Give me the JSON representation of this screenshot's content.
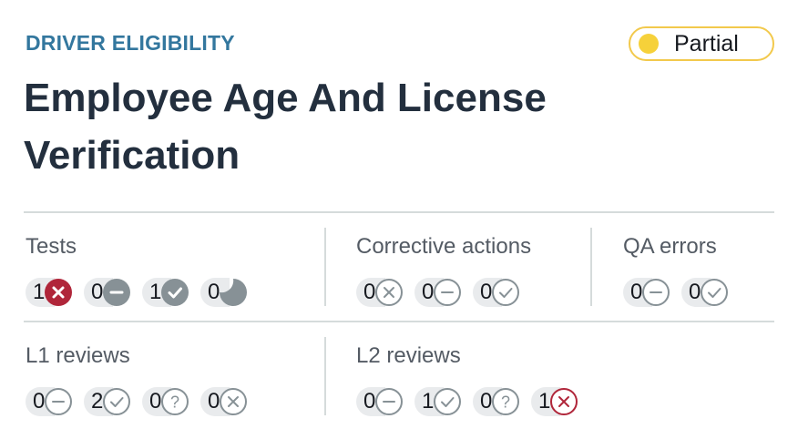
{
  "header": {
    "category": "DRIVER ELIGIBILITY",
    "title": "Employee Age And License Verification",
    "status": {
      "label": "Partial",
      "color": "#f6d13a",
      "border_color": "#f2c94c"
    }
  },
  "sections": {
    "tests": {
      "title": "Tests",
      "badges": [
        {
          "count": "1",
          "icon": "failed-icon"
        },
        {
          "count": "0",
          "icon": "not-applicable-icon"
        },
        {
          "count": "1",
          "icon": "passed-icon"
        },
        {
          "count": "0",
          "icon": "in-progress-icon"
        }
      ]
    },
    "corrective_actions": {
      "title": "Corrective actions",
      "badges": [
        {
          "count": "0",
          "icon": "rejected-outline-icon"
        },
        {
          "count": "0",
          "icon": "not-applicable-outline-icon"
        },
        {
          "count": "0",
          "icon": "approved-outline-icon"
        }
      ]
    },
    "qa_errors": {
      "title": "QA errors",
      "badges": [
        {
          "count": "0",
          "icon": "not-applicable-outline-icon"
        },
        {
          "count": "0",
          "icon": "approved-outline-icon"
        }
      ]
    },
    "l1_reviews": {
      "title": "L1 reviews",
      "badges": [
        {
          "count": "0",
          "icon": "not-applicable-outline-icon"
        },
        {
          "count": "2",
          "icon": "approved-outline-icon"
        },
        {
          "count": "0",
          "icon": "pending-outline-icon"
        },
        {
          "count": "0",
          "icon": "rejected-outline-icon"
        }
      ]
    },
    "l2_reviews": {
      "title": "L2 reviews",
      "badges": [
        {
          "count": "0",
          "icon": "not-applicable-outline-icon"
        },
        {
          "count": "1",
          "icon": "approved-outline-icon"
        },
        {
          "count": "0",
          "icon": "pending-outline-icon"
        },
        {
          "count": "1",
          "icon": "rejected-red-outline-icon"
        }
      ]
    }
  },
  "colors": {
    "category": "#33779e",
    "title": "#232f3e",
    "failed": "#b0263a",
    "neutral": "#879196",
    "count_bg": "#e9ebed",
    "divider": "#d5dbdb"
  }
}
